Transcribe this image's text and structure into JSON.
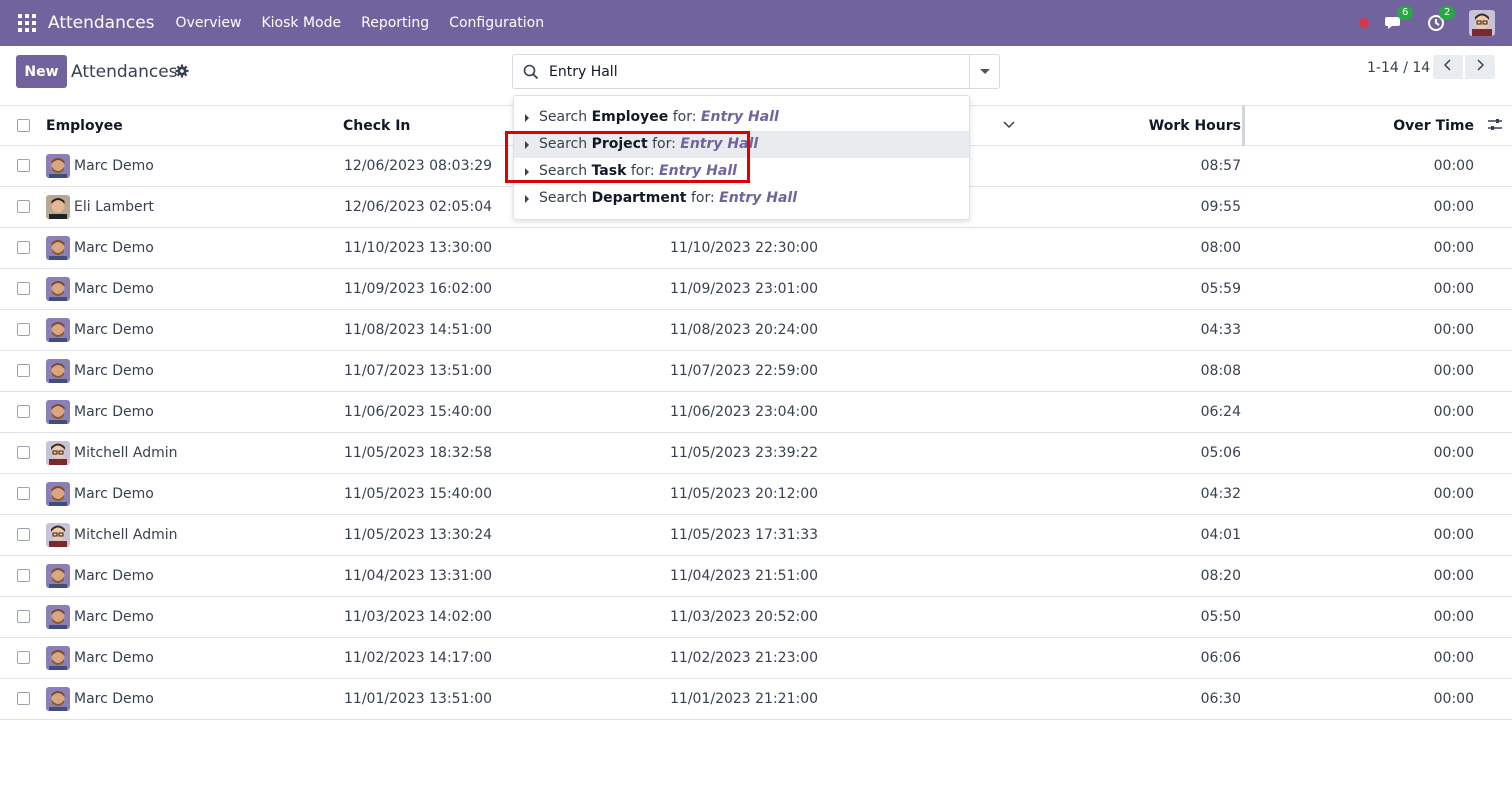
{
  "navbar": {
    "app_name": "Attendances",
    "menu": [
      "Overview",
      "Kiosk Mode",
      "Reporting",
      "Configuration"
    ],
    "messages_count": "6",
    "activities_count": "2",
    "colors": {
      "brand": "#71639e",
      "badge": "#28a745",
      "record": "#dc3545"
    }
  },
  "control": {
    "new_label": "New",
    "breadcrumb": "Attendances",
    "search_value": "Entry Hall",
    "pager": "1-14 / 14"
  },
  "search_dropdown": {
    "items": [
      {
        "prefix": "Search",
        "field": "Employee",
        "for": "for:",
        "term": "Entry Hall"
      },
      {
        "prefix": "Search",
        "field": "Project",
        "for": "for:",
        "term": "Entry Hall"
      },
      {
        "prefix": "Search",
        "field": "Task",
        "for": "for:",
        "term": "Entry Hall"
      },
      {
        "prefix": "Search",
        "field": "Department",
        "for": "for:",
        "term": "Entry Hall"
      }
    ],
    "active_index": 1
  },
  "table": {
    "headers": {
      "employee": "Employee",
      "check_in": "Check In",
      "work_hours": "Work Hours",
      "over_time": "Over Time"
    },
    "rows": [
      {
        "employee": "Marc Demo",
        "avatar": "marc",
        "check_in": "12/06/2023 08:03:29",
        "check_out": "",
        "work_hours": "08:57",
        "over_time": "00:00"
      },
      {
        "employee": "Eli Lambert",
        "avatar": "eli",
        "check_in": "12/06/2023 02:05:04",
        "check_out": "",
        "work_hours": "09:55",
        "over_time": "00:00"
      },
      {
        "employee": "Marc Demo",
        "avatar": "marc",
        "check_in": "11/10/2023 13:30:00",
        "check_out": "11/10/2023 22:30:00",
        "work_hours": "08:00",
        "over_time": "00:00"
      },
      {
        "employee": "Marc Demo",
        "avatar": "marc",
        "check_in": "11/09/2023 16:02:00",
        "check_out": "11/09/2023 23:01:00",
        "work_hours": "05:59",
        "over_time": "00:00"
      },
      {
        "employee": "Marc Demo",
        "avatar": "marc",
        "check_in": "11/08/2023 14:51:00",
        "check_out": "11/08/2023 20:24:00",
        "work_hours": "04:33",
        "over_time": "00:00"
      },
      {
        "employee": "Marc Demo",
        "avatar": "marc",
        "check_in": "11/07/2023 13:51:00",
        "check_out": "11/07/2023 22:59:00",
        "work_hours": "08:08",
        "over_time": "00:00"
      },
      {
        "employee": "Marc Demo",
        "avatar": "marc",
        "check_in": "11/06/2023 15:40:00",
        "check_out": "11/06/2023 23:04:00",
        "work_hours": "06:24",
        "over_time": "00:00"
      },
      {
        "employee": "Mitchell Admin",
        "avatar": "mitchell",
        "check_in": "11/05/2023 18:32:58",
        "check_out": "11/05/2023 23:39:22",
        "work_hours": "05:06",
        "over_time": "00:00"
      },
      {
        "employee": "Marc Demo",
        "avatar": "marc",
        "check_in": "11/05/2023 15:40:00",
        "check_out": "11/05/2023 20:12:00",
        "work_hours": "04:32",
        "over_time": "00:00"
      },
      {
        "employee": "Mitchell Admin",
        "avatar": "mitchell",
        "check_in": "11/05/2023 13:30:24",
        "check_out": "11/05/2023 17:31:33",
        "work_hours": "04:01",
        "over_time": "00:00"
      },
      {
        "employee": "Marc Demo",
        "avatar": "marc",
        "check_in": "11/04/2023 13:31:00",
        "check_out": "11/04/2023 21:51:00",
        "work_hours": "08:20",
        "over_time": "00:00"
      },
      {
        "employee": "Marc Demo",
        "avatar": "marc",
        "check_in": "11/03/2023 14:02:00",
        "check_out": "11/03/2023 20:52:00",
        "work_hours": "05:50",
        "over_time": "00:00"
      },
      {
        "employee": "Marc Demo",
        "avatar": "marc",
        "check_in": "11/02/2023 14:17:00",
        "check_out": "11/02/2023 21:23:00",
        "work_hours": "06:06",
        "over_time": "00:00"
      },
      {
        "employee": "Marc Demo",
        "avatar": "marc",
        "check_in": "11/01/2023 13:51:00",
        "check_out": "11/01/2023 21:21:00",
        "work_hours": "06:30",
        "over_time": "00:00"
      }
    ]
  }
}
